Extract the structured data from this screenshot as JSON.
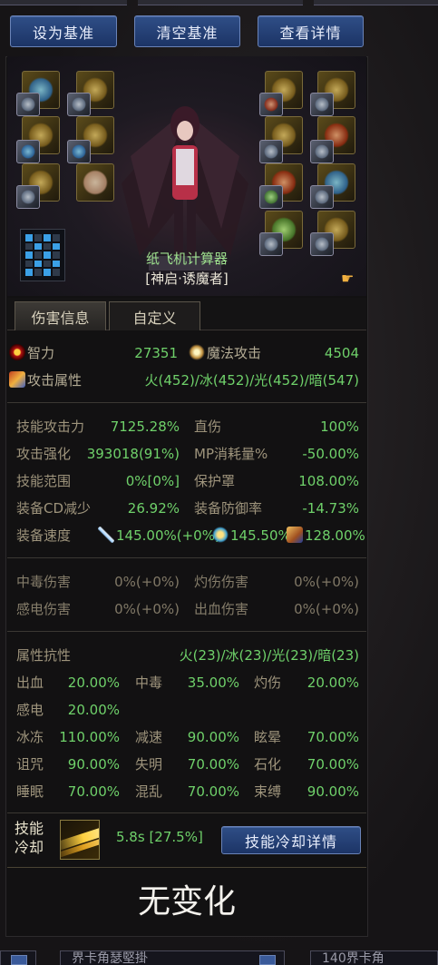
{
  "buttons": {
    "set_baseline": "设为基准",
    "clear_baseline": "清空基准",
    "view_details": "查看详情"
  },
  "character": {
    "calculator_name": "纸飞机计算器",
    "class_name": "[神启·诱魔者]"
  },
  "tabs": [
    "伤害信息",
    "自定义"
  ],
  "primary_stats": [
    {
      "icon": "eye-icon",
      "label": "智力",
      "value": "27351",
      "icon2": "magic-spark-icon",
      "label2": "魔法攻击",
      "value2": "4504"
    }
  ],
  "attack_attribute": {
    "label": "攻击属性",
    "value": "火(452)/冰(452)/光(452)/暗(547)"
  },
  "skill_stats": [
    {
      "label": "技能攻击力",
      "value": "7125.28%",
      "label2": "直伤",
      "value2": "100%"
    },
    {
      "label": "攻击强化",
      "value": "393018(91%)",
      "label2": "MP消耗量%",
      "value2": "-50.00%"
    },
    {
      "label": "技能范围",
      "value": "0%[0%]",
      "label2": "保护罩",
      "value2": "108.00%"
    },
    {
      "label": "装备CD减少",
      "value": "26.92%",
      "label2": "装备防御率",
      "value2": "-14.73%"
    }
  ],
  "equip_speed": {
    "label": "装备速度",
    "attack_speed": "145.00%(+0%)",
    "cast_speed": "145.50%",
    "move_speed": "128.00%"
  },
  "dot_damage": [
    {
      "label": "中毒伤害",
      "value": "0%(+0%)",
      "label2": "灼伤伤害",
      "value2": "0%(+0%)"
    },
    {
      "label": "感电伤害",
      "value": "0%(+0%)",
      "label2": "出血伤害",
      "value2": "0%(+0%)"
    }
  ],
  "resistance": {
    "label": "属性抗性",
    "value": "火(23)/冰(23)/光(23)/暗(23)",
    "rows": [
      [
        {
          "label": "出血",
          "value": "20.00%"
        },
        {
          "label": "中毒",
          "value": "35.00%"
        },
        {
          "label": "灼伤",
          "value": "20.00%"
        }
      ],
      [
        {
          "label": "感电",
          "value": "20.00%"
        }
      ],
      [
        {
          "label": "冰冻",
          "value": "110.00%"
        },
        {
          "label": "减速",
          "value": "90.00%"
        },
        {
          "label": "眩晕",
          "value": "70.00%"
        }
      ],
      [
        {
          "label": "诅咒",
          "value": "90.00%"
        },
        {
          "label": "失明",
          "value": "70.00%"
        },
        {
          "label": "石化",
          "value": "70.00%"
        }
      ],
      [
        {
          "label": "睡眠",
          "value": "70.00%"
        },
        {
          "label": "混乱",
          "value": "70.00%"
        },
        {
          "label": "束缚",
          "value": "90.00%"
        }
      ]
    ]
  },
  "cooldown": {
    "label_line1": "技能",
    "label_line2": "冷却",
    "value": "5.8s [27.5%]",
    "details_button": "技能冷却详情"
  },
  "comparison_result": "无变化",
  "bottom_bar": {
    "left_text": "界卡角瑟堅掛",
    "right_text": "140界卡角"
  },
  "colors": {
    "value_green": "#6fd16a",
    "button_blue": "#2f4e86",
    "label_tan": "#9e947c"
  }
}
